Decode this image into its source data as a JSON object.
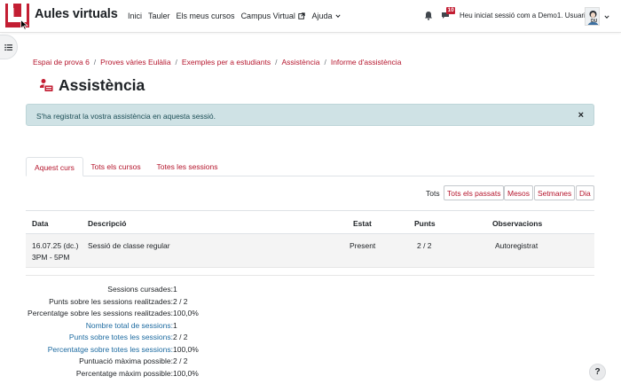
{
  "navbar": {
    "brand": "Aules virtuals",
    "links": [
      "Inici",
      "Tauler",
      "Els meus cursos",
      "Campus Virtual",
      "Ajuda"
    ],
    "message_count": "10",
    "user_text": "Heu iniciat sessió com a Demo1. Usuari",
    "avatar_initials": "DU"
  },
  "breadcrumb": [
    "Espai de prova 6",
    "Proves vàries Eulàlia",
    "Exemples per a estudiants",
    "Assistència",
    "Informe d'assistència"
  ],
  "page_title": "Assistència",
  "alert": {
    "message": "S'ha registrat la vostra assistència en aquesta sessió.",
    "close": "×"
  },
  "tabs": [
    "Aquest curs",
    "Tots els cursos",
    "Totes les sessions"
  ],
  "filters": {
    "label": "Tots",
    "buttons": [
      "Tots els passats",
      "Mesos",
      "Setmanes",
      "Dia"
    ]
  },
  "table": {
    "headers": [
      "Data",
      "Descripció",
      "Estat",
      "Punts",
      "Observacions"
    ],
    "rows": [
      {
        "date": "16.07.25 (dc.)",
        "time": "3PM - 5PM",
        "description": "Sessió de classe regular",
        "status": "Present",
        "points": "2 / 2",
        "remarks": "Autoregistrat"
      }
    ]
  },
  "summary": [
    {
      "label": "Sessions cursades:",
      "value": "1"
    },
    {
      "label": "Punts sobre les sessions realitzades:",
      "value": "2 / 2"
    },
    {
      "label": "Percentatge sobre les sessions realitzades:",
      "value": "100,0%"
    },
    {
      "label": "Nombre total de sessions:",
      "value": "1"
    },
    {
      "label": "Punts sobre totes les sessions:",
      "value": "2 / 2"
    },
    {
      "label": "Percentatge sobre totes les sessions:",
      "value": "100,0%"
    },
    {
      "label": "Puntuació màxima possible:",
      "value": "2 / 2"
    },
    {
      "label": "Percentatge màxim possible:",
      "value": "100,0%"
    }
  ],
  "help": "?",
  "colors": {
    "brand_red": "#c31e33",
    "link_red": "#b5162d",
    "alert_bg": "#cfe2e5",
    "info_blue": "#1c6aa0"
  },
  "icons": [
    "logo-icon",
    "external-link-icon",
    "chevron-down-icon",
    "bell-icon",
    "message-icon",
    "list-icon",
    "attendance-icon",
    "close-icon",
    "help-icon"
  ]
}
